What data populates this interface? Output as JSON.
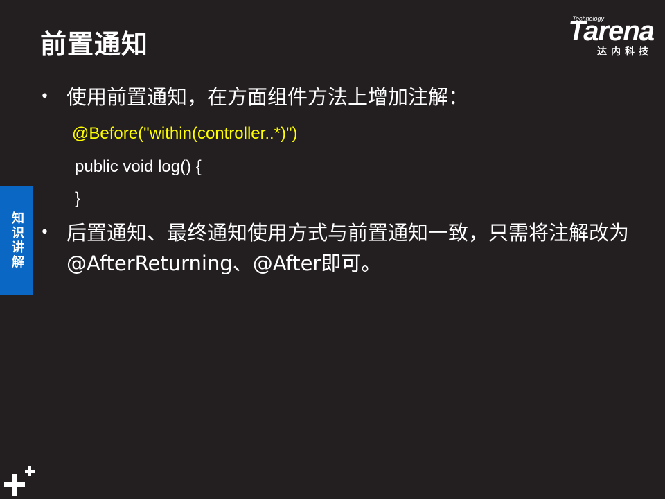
{
  "slide": {
    "title": "前置通知",
    "logo": {
      "tagline": "Technology",
      "brand": "Tarena",
      "chinese": "达内科技"
    },
    "side_tab": "知识讲解",
    "bullets": [
      "使用前置通知，在方面组件方法上增加注解：",
      "后置通知、最终通知使用方式与前置通知一致，只需将注解改为@AfterReturning、@After即可。"
    ],
    "code_lines": [
      "@Before(\"within(controller..*)\")",
      "public void log() {",
      "}"
    ],
    "colors": {
      "background": "#231f20",
      "code_highlight": "#ffff00",
      "side_tab": "#0a67c4"
    }
  }
}
